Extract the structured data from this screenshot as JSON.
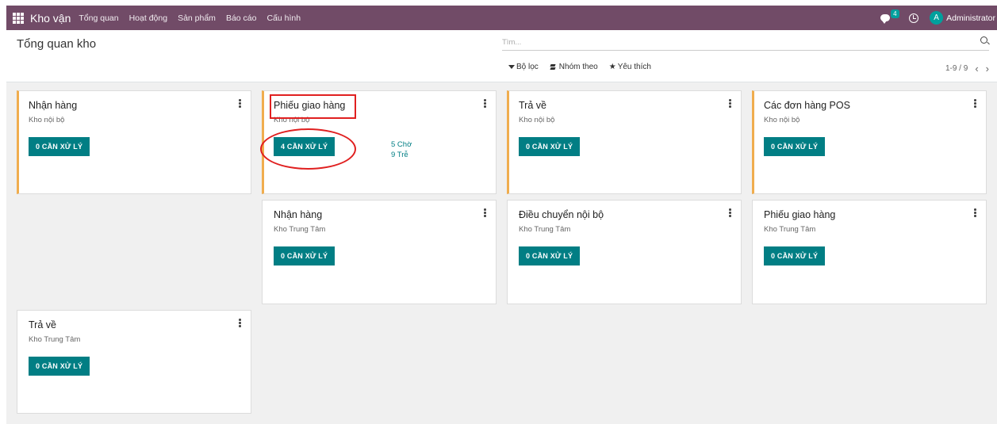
{
  "navbar": {
    "brand": "Kho vận",
    "menu": [
      "Tổng quan",
      "Hoạt động",
      "Sản phẩm",
      "Báo cáo",
      "Cấu hình"
    ],
    "chat_count": "4",
    "avatar_letter": "A",
    "user": "Administrator",
    "bg_color": "#714B67"
  },
  "control": {
    "title": "Tổng quan kho",
    "search_placeholder": "Tìm...",
    "filter_label": "Bộ lọc",
    "group_label": "Nhóm theo",
    "favorite_label": "Yêu thích",
    "pager": "1-9 / 9"
  },
  "cards": [
    {
      "title": "Nhận hàng",
      "subtitle": "Kho nội bộ",
      "button": "0 CẦN XỬ LÝ"
    },
    {
      "title": "Phiếu giao hàng",
      "subtitle": "Kho nội bộ",
      "button": "4 CẦN XỬ LÝ",
      "waiting": "5 Chờ",
      "late": "9 Trễ"
    },
    {
      "title": "Trả về",
      "subtitle": "Kho nội bộ",
      "button": "0 CẦN XỬ LÝ"
    },
    {
      "title": "Các đơn hàng POS",
      "subtitle": "Kho nội bộ",
      "button": "0 CẦN XỬ LÝ"
    },
    {
      "title": "Nhận hàng",
      "subtitle": "Kho Trung Tâm",
      "button": "0 CẦN XỬ LÝ"
    },
    {
      "title": "Điều chuyển nội bộ",
      "subtitle": "Kho Trung Tâm",
      "button": "0 CẦN XỬ LÝ"
    },
    {
      "title": "Phiếu giao hàng",
      "subtitle": "Kho Trung Tâm",
      "button": "0 CẦN XỬ LÝ"
    },
    {
      "title": "Trả về",
      "subtitle": "Kho Trung Tâm",
      "button": "0 CẦN XỬ LÝ"
    }
  ],
  "colors": {
    "primary": "#017e84",
    "alert_border": "#f0ad4e",
    "annotation": "#e02020"
  }
}
